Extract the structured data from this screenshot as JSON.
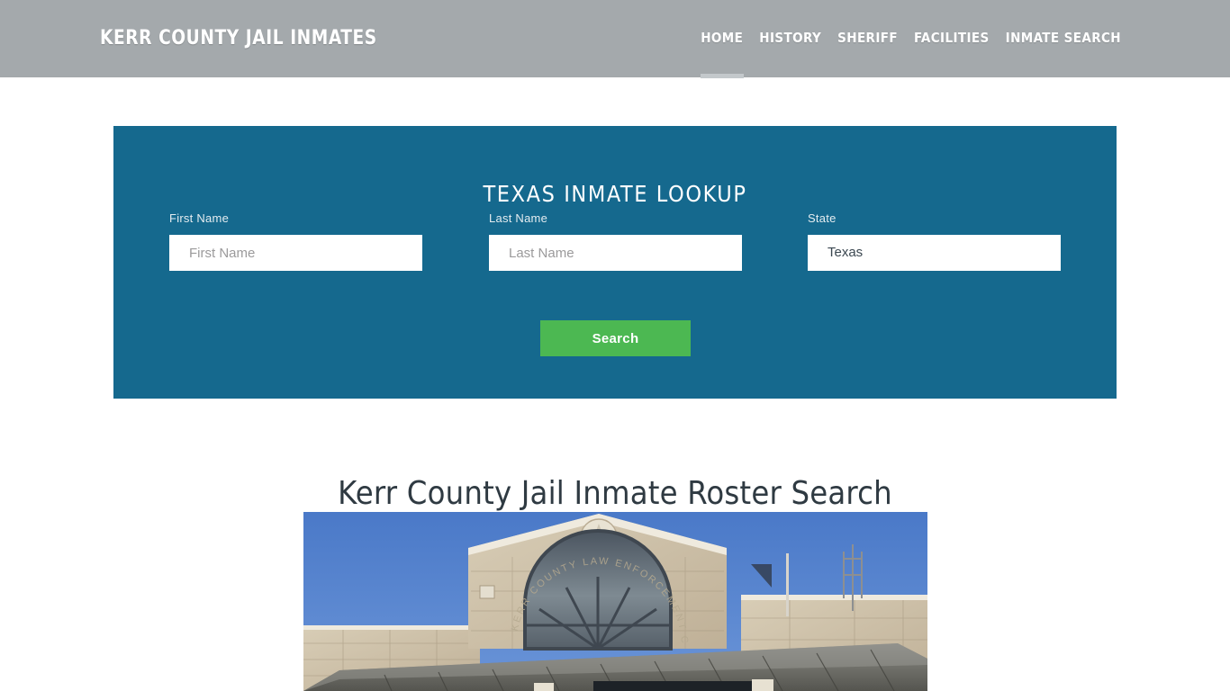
{
  "header": {
    "brand": "KERR COUNTY JAIL INMATES",
    "nav": [
      {
        "label": "HOME",
        "active": true
      },
      {
        "label": "HISTORY",
        "active": false
      },
      {
        "label": "SHERIFF",
        "active": false
      },
      {
        "label": "FACILITIES",
        "active": false
      },
      {
        "label": "INMATE SEARCH",
        "active": false
      }
    ]
  },
  "lookup": {
    "title": "TEXAS INMATE LOOKUP",
    "fields": {
      "first": {
        "label": "First Name",
        "placeholder": "First Name",
        "value": ""
      },
      "last": {
        "label": "Last Name",
        "placeholder": "Last Name",
        "value": ""
      },
      "state": {
        "label": "State",
        "value": "Texas",
        "options": [
          "Texas"
        ]
      }
    },
    "search_button": "Search"
  },
  "main": {
    "heading": "Kerr County Jail Inmate Roster Search",
    "photo_alt": "Kerr County Law Enforcement Center building facade"
  },
  "colors": {
    "header_gray": "#a4a9ac",
    "panel_blue": "#15698e",
    "button_green": "#4cb852",
    "heading_dark": "#2f3a42",
    "sky_blue": "#5181cd",
    "stone": "#cfc4ae",
    "roof": "#6b6b68"
  }
}
